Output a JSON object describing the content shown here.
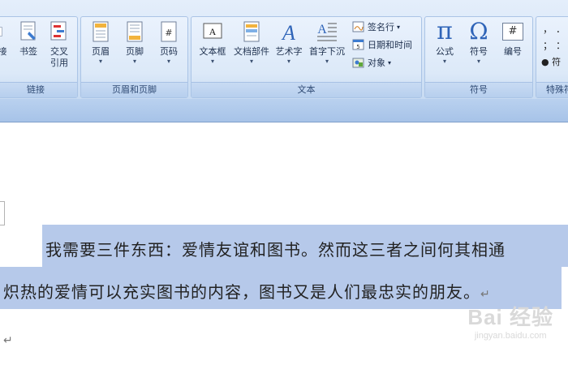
{
  "ribbon": {
    "groups": {
      "links": {
        "label": "链接",
        "buttons": [
          {
            "label": "接"
          },
          {
            "label": "书签"
          },
          {
            "label": "交叉",
            "label2": "引用"
          }
        ]
      },
      "header_footer": {
        "label": "页眉和页脚",
        "buttons": [
          {
            "label": "页眉"
          },
          {
            "label": "页脚"
          },
          {
            "label": "页码"
          }
        ]
      },
      "text": {
        "label": "文本",
        "buttons": [
          {
            "label": "文本框"
          },
          {
            "label": "文档部件"
          },
          {
            "label": "艺术字"
          },
          {
            "label": "首字下沉"
          }
        ],
        "small_buttons": [
          {
            "label": "签名行"
          },
          {
            "label": "日期和时间"
          },
          {
            "label": "对象"
          }
        ]
      },
      "symbols": {
        "label": "符号",
        "buttons": [
          {
            "label": "公式"
          },
          {
            "label": "符号"
          },
          {
            "label": "编号"
          }
        ]
      },
      "special": {
        "label": "特殊符",
        "items": [
          "，",
          "．",
          "；",
          "：",
          "符"
        ]
      }
    },
    "icons": {
      "pi": "π",
      "omega": "Ω",
      "numbering": "#"
    }
  },
  "document": {
    "line1": "我需要三件东西：爱情友谊和图书。然而这三者之间何其相通",
    "line2": "炽热的爱情可以充实图书的内容，图书又是人们最忠实的朋友。",
    "paragraph_mark": "↵"
  },
  "watermark": {
    "brand": "Bai 经验",
    "url": "jingyan.baidu.com"
  }
}
